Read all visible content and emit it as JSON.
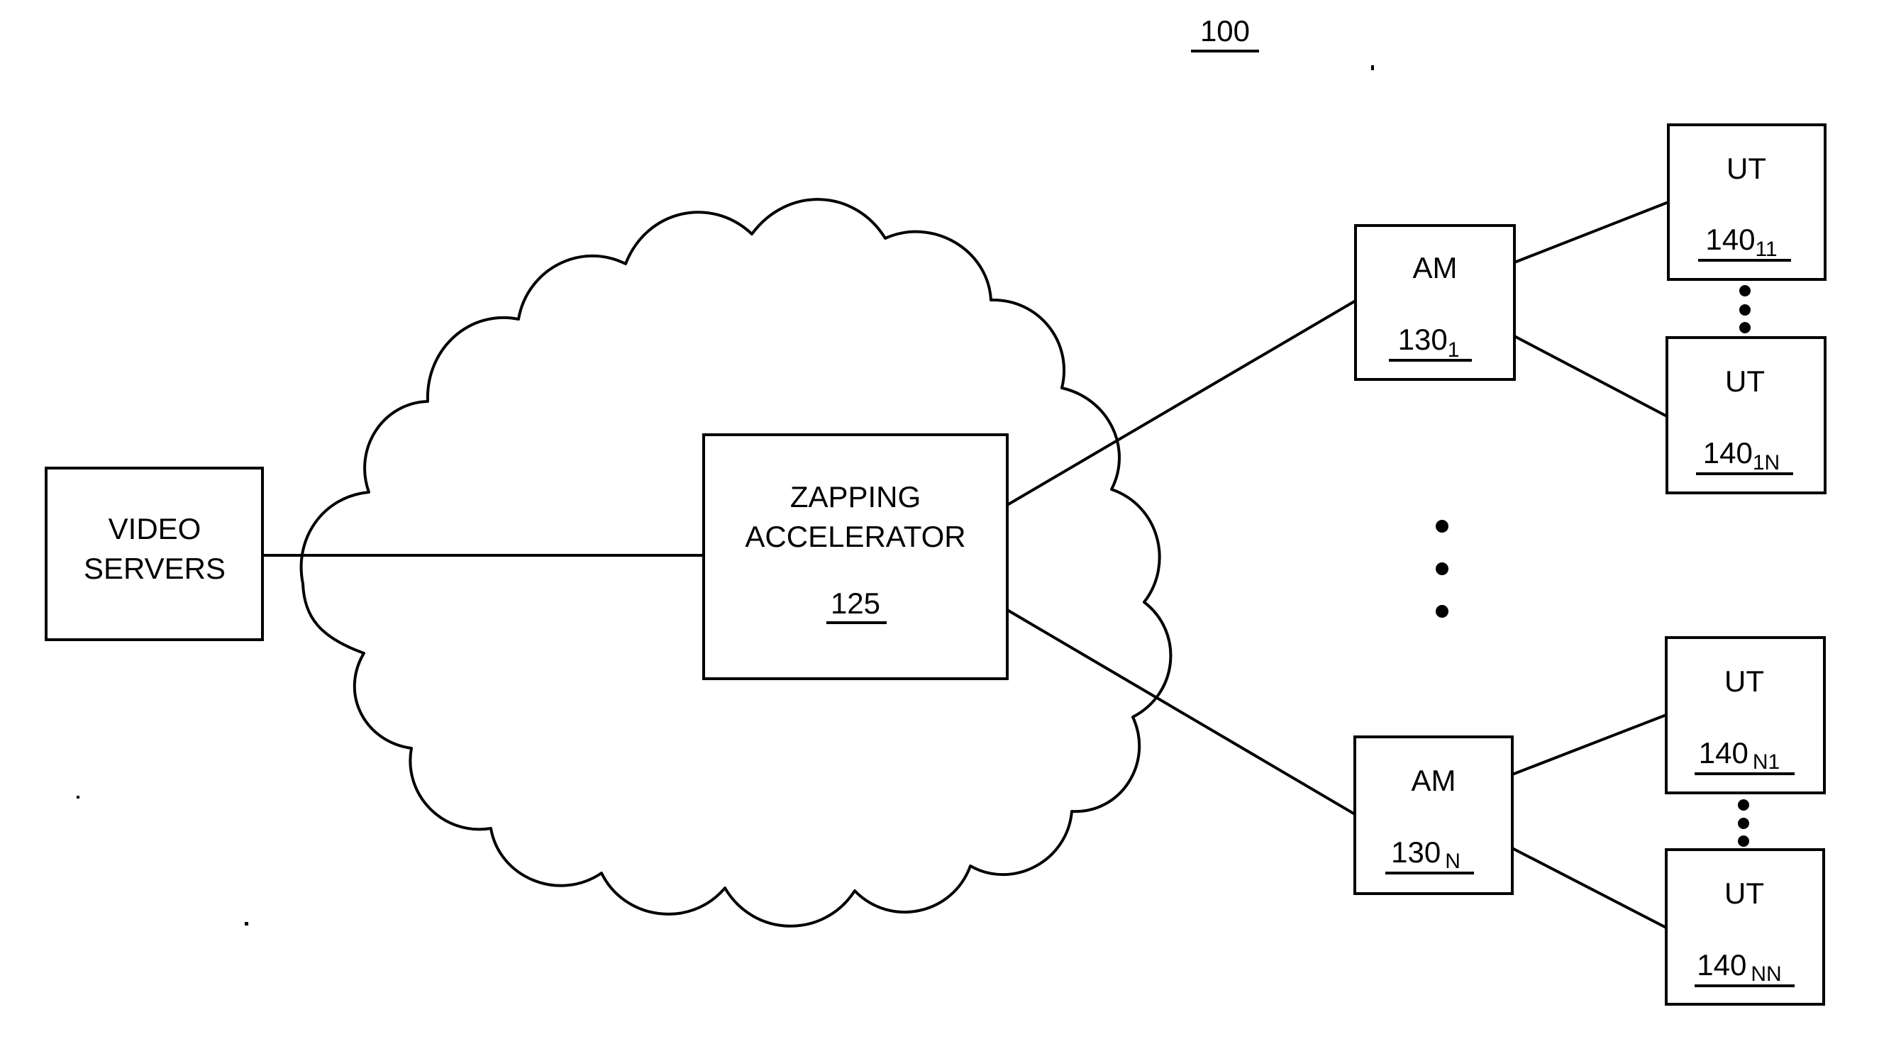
{
  "figure": {
    "number": "100",
    "type": "patent-diagram",
    "background_color": "#ffffff",
    "line_color": "#000000"
  },
  "nodes": {
    "video_servers": {
      "label_line1": "VIDEO",
      "label_line2": "SERVERS",
      "ref": "",
      "ref_sub": ""
    },
    "zapping_accelerator": {
      "label_line1": "ZAPPING",
      "label_line2": "ACCELERATOR",
      "ref": "125",
      "ref_sub": ""
    },
    "am_1": {
      "label_line1": "AM",
      "label_line2": "",
      "ref": "130",
      "ref_sub": "1"
    },
    "am_n": {
      "label_line1": "AM",
      "label_line2": "",
      "ref": "130",
      "ref_sub": "N"
    },
    "ut_11": {
      "label_line1": "UT",
      "label_line2": "",
      "ref": "140",
      "ref_sub": "11"
    },
    "ut_1n": {
      "label_line1": "UT",
      "label_line2": "",
      "ref": "140",
      "ref_sub": "1N"
    },
    "ut_n1": {
      "label_line1": "UT",
      "label_line2": "",
      "ref": "140",
      "ref_sub": "N1"
    },
    "ut_nn": {
      "label_line1": "UT",
      "label_line2": "",
      "ref": "140",
      "ref_sub": "NN"
    }
  },
  "cloud": {
    "name": "network-cloud",
    "label": ""
  },
  "ellipses": {
    "between_ut_1_group": "vertical-ellipsis",
    "between_am_groups": "vertical-ellipsis",
    "between_ut_n_group": "vertical-ellipsis"
  },
  "connections": [
    {
      "from": "video_servers",
      "to": "cloud"
    },
    {
      "from": "cloud",
      "to": "zapping_accelerator"
    },
    {
      "from": "zapping_accelerator",
      "to": "am_1"
    },
    {
      "from": "zapping_accelerator",
      "to": "am_n"
    },
    {
      "from": "am_1",
      "to": "ut_11"
    },
    {
      "from": "am_1",
      "to": "ut_1n"
    },
    {
      "from": "am_n",
      "to": "ut_n1"
    },
    {
      "from": "am_n",
      "to": "ut_nn"
    }
  ]
}
